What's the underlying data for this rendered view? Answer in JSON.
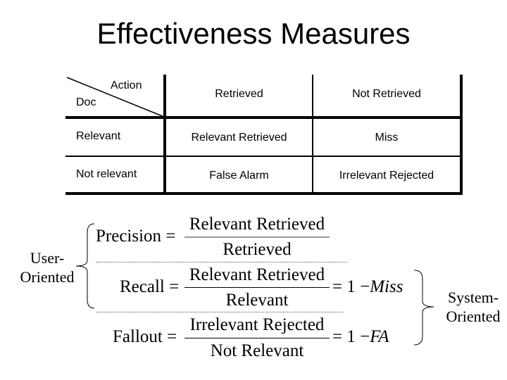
{
  "title": "Effectiveness Measures",
  "table": {
    "corner": {
      "action_label": "Action",
      "doc_label": "Doc"
    },
    "columns": [
      "Retrieved",
      "Not Retrieved"
    ],
    "rows": [
      {
        "label": "Relevant",
        "cells": [
          "Relevant Retrieved",
          "Miss"
        ]
      },
      {
        "label": "Not relevant",
        "cells": [
          "False Alarm",
          "Irrelevant Rejected"
        ]
      }
    ]
  },
  "formulas": {
    "precision": {
      "name": "Precision",
      "eq": "=",
      "numerator": "Relevant Retrieved",
      "denominator": "Retrieved"
    },
    "recall": {
      "name": "Recall",
      "eq": "=",
      "numerator": "Relevant Retrieved",
      "denominator": "Relevant",
      "rhs_prefix": "= 1 −",
      "rhs_var": "Miss"
    },
    "fallout": {
      "name": "Fallout",
      "eq": "=",
      "numerator": "Irrelevant Rejected",
      "denominator": "Not Relevant",
      "rhs_prefix": "= 1 −",
      "rhs_var": "FA"
    }
  },
  "groups": {
    "user": {
      "line1": "User-",
      "line2": "Oriented"
    },
    "system": {
      "line1": "System-",
      "line2": "Oriented"
    }
  }
}
